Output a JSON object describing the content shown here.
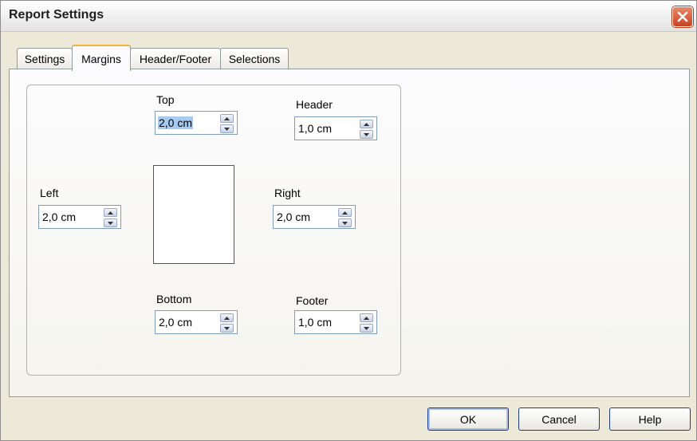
{
  "window": {
    "title": "Report Settings",
    "close_icon": "close-icon"
  },
  "tabs": [
    {
      "label": "Settings",
      "active": false
    },
    {
      "label": "Margins",
      "active": true
    },
    {
      "label": "Header/Footer",
      "active": false
    },
    {
      "label": "Selections",
      "active": false
    }
  ],
  "margins": {
    "top": {
      "label": "Top",
      "value": "2,0 cm"
    },
    "header": {
      "label": "Header",
      "value": "1,0 cm"
    },
    "left": {
      "label": "Left",
      "value": "2,0 cm"
    },
    "right": {
      "label": "Right",
      "value": "2,0 cm"
    },
    "bottom": {
      "label": "Bottom",
      "value": "2,0 cm"
    },
    "footer": {
      "label": "Footer",
      "value": "1,0 cm"
    }
  },
  "buttons": {
    "ok": "OK",
    "cancel": "Cancel",
    "help": "Help"
  },
  "colors": {
    "selection": "#a6caf0",
    "close_button": "#c8411f",
    "active_tab_accent": "#f0b23b"
  }
}
